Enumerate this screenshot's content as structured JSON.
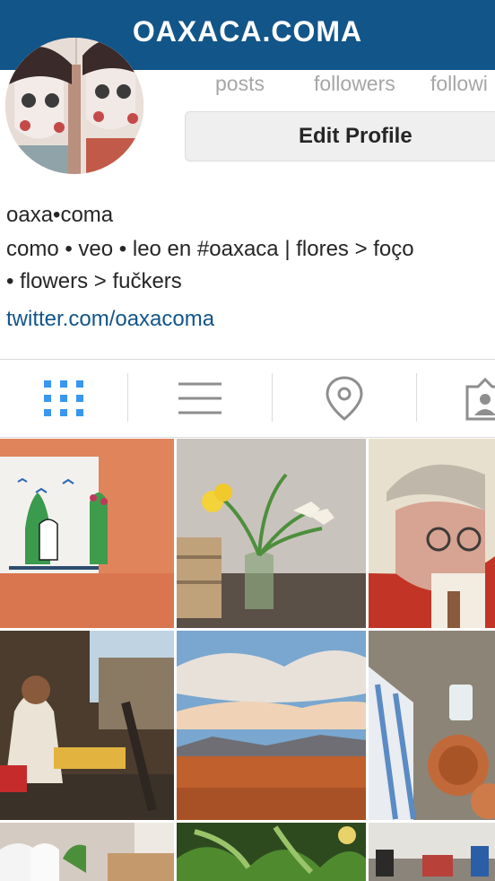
{
  "header": {
    "title": "OAXACA.COMA",
    "bg_color": "#125589"
  },
  "profile": {
    "stats": [
      {
        "label": "posts"
      },
      {
        "label": "followers"
      },
      {
        "label": "followi"
      }
    ],
    "edit_button_label": "Edit Profile"
  },
  "bio": {
    "name": "oaxa•coma",
    "line1": "como • veo • leo en #oaxaca | flores > foço",
    "line2": "• flowers > fučkers",
    "link": "twitter.com/oaxacoma",
    "link_color": "#125589"
  },
  "tabs": [
    {
      "icon": "grid-icon",
      "active": true
    },
    {
      "icon": "list-icon",
      "active": false
    },
    {
      "icon": "location-pin-icon",
      "active": false
    },
    {
      "icon": "tagged-person-icon",
      "active": false
    }
  ],
  "accent_color": "#3897f0",
  "posts": [
    {
      "subject": "cactus wall painting"
    },
    {
      "subject": "yellow flowers in glass"
    },
    {
      "subject": "man with glasses portrait"
    },
    {
      "subject": "woman at street market"
    },
    {
      "subject": "desert landscape sky"
    },
    {
      "subject": "clay pots on table"
    },
    {
      "subject": "white figurines"
    },
    {
      "subject": "green herbs"
    },
    {
      "subject": "wall with objects"
    }
  ]
}
